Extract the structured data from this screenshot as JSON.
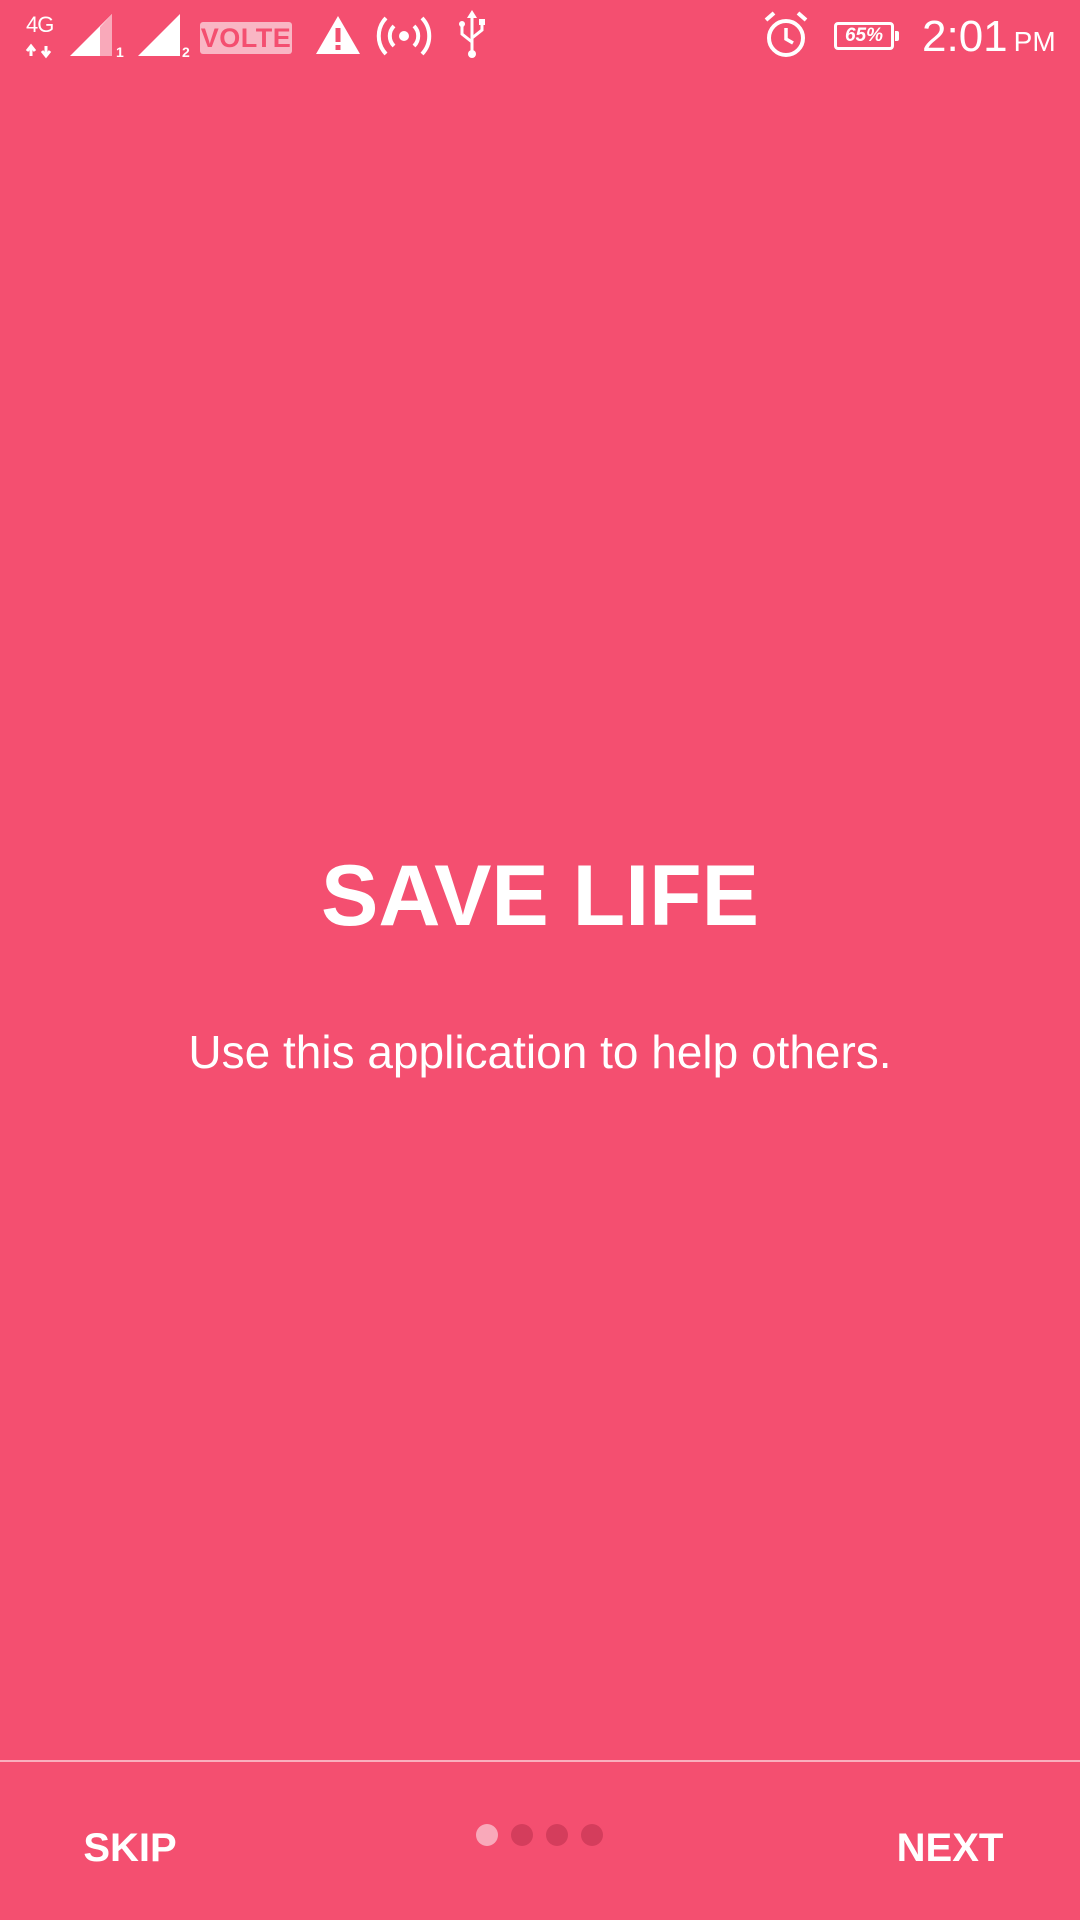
{
  "status_bar": {
    "network_type": "4G",
    "sim1_label": "1",
    "sim2_label": "2",
    "volte_label": "VOLTE",
    "battery_level": "65%",
    "time": "2:01",
    "ampm": "PM",
    "icons": [
      "network-arrows-icon",
      "signal-sim1-icon",
      "signal-sim2-icon",
      "warning-icon",
      "hotspot-icon",
      "usb-icon",
      "alarm-icon",
      "battery-icon"
    ]
  },
  "slide": {
    "title": "SAVE LIFE",
    "description": "Use this application to help others.",
    "current_page": 1,
    "total_pages": 4
  },
  "bottom_bar": {
    "skip_label": "SKIP",
    "next_label": "NEXT"
  },
  "colors": {
    "background": "#F44F70",
    "text": "#FFFFFF",
    "dot_active": "#F9A9BA",
    "dot_inactive": "#D43D5C"
  }
}
